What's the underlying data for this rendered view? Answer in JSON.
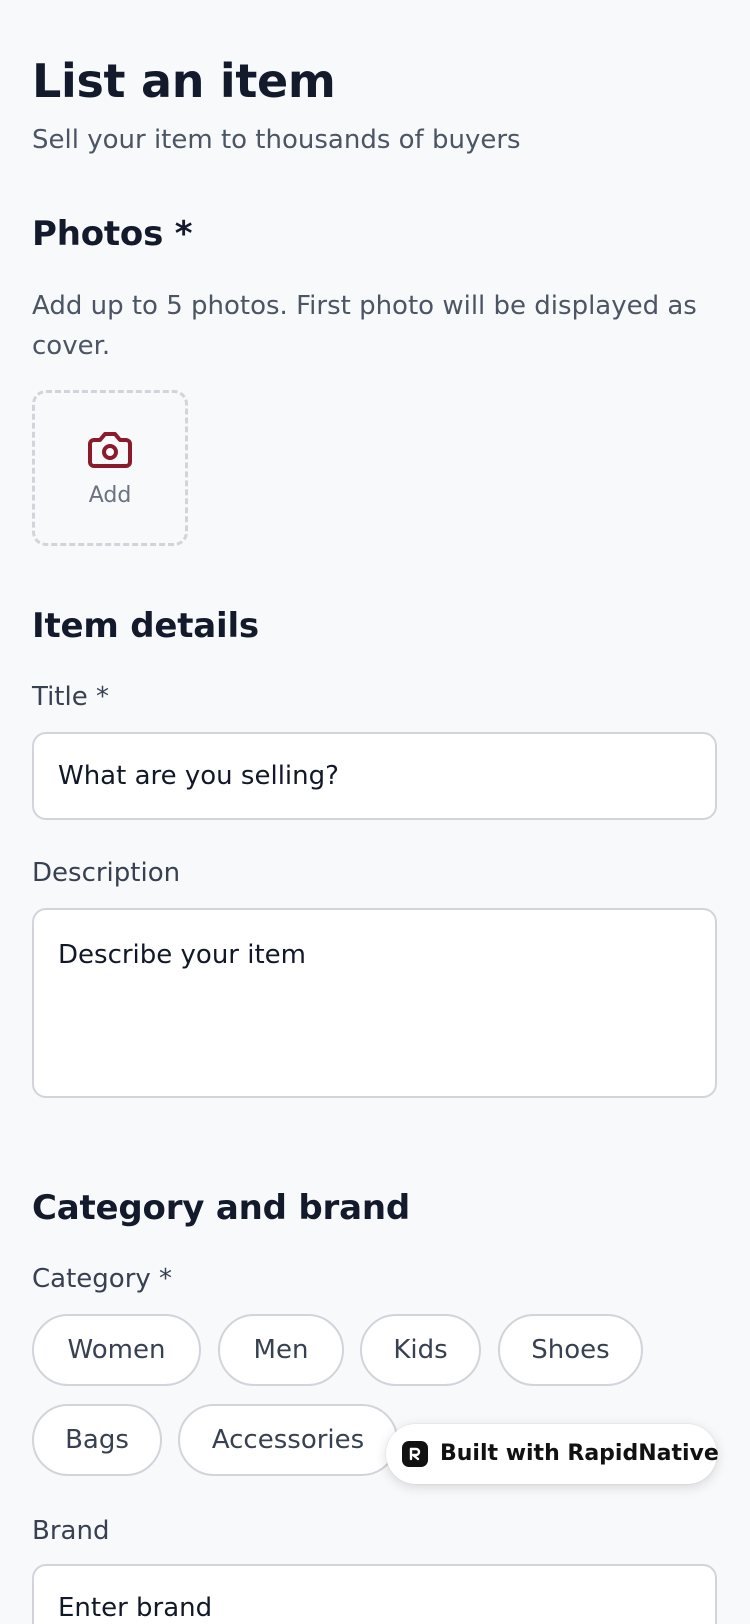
{
  "header": {
    "title": "List an item",
    "subtitle": "Sell your item to thousands of buyers"
  },
  "photos": {
    "heading": "Photos *",
    "help": "Add up to 5 photos. First photo will be displayed as cover.",
    "add_label": "Add",
    "add_icon": "camera-icon"
  },
  "item_details": {
    "heading": "Item details",
    "title_label": "Title *",
    "title_placeholder": "What are you selling?",
    "description_label": "Description",
    "description_placeholder": "Describe your item"
  },
  "category_brand": {
    "heading": "Category and brand",
    "category_label": "Category *",
    "categories": [
      "Women",
      "Men",
      "Kids",
      "Shoes",
      "Bags",
      "Accessories"
    ],
    "brand_label": "Brand",
    "brand_placeholder": "Enter brand"
  },
  "badge": {
    "text": "Built with RapidNative",
    "icon": "rapidnative-logo-icon"
  },
  "colors": {
    "accent": "#8b1a2b",
    "background": "#f8f9fb",
    "heading": "#131a2b",
    "muted_text": "#4b5563",
    "border": "#d1d5db"
  }
}
